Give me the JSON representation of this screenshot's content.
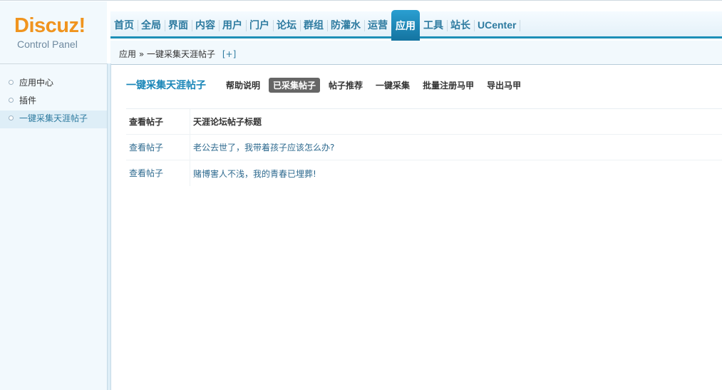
{
  "logo": {
    "word": "Discuz!",
    "sub": "Control Panel"
  },
  "nav": [
    {
      "label": "首页"
    },
    {
      "label": "全局"
    },
    {
      "label": "界面"
    },
    {
      "label": "内容"
    },
    {
      "label": "用户"
    },
    {
      "label": "门户"
    },
    {
      "label": "论坛"
    },
    {
      "label": "群组"
    },
    {
      "label": "防灌水"
    },
    {
      "label": "运营"
    },
    {
      "label": "应用",
      "active": true
    },
    {
      "label": "工具"
    },
    {
      "label": "站长"
    },
    {
      "label": "UCenter"
    }
  ],
  "breadcrumb": {
    "root": "应用",
    "sep": "»",
    "current": "一键采集天涯帖子",
    "plus": "[+]"
  },
  "sidebar": {
    "items": [
      {
        "label": "应用中心"
      },
      {
        "label": "插件"
      },
      {
        "label": "一键采集天涯帖子",
        "active": true
      }
    ]
  },
  "main": {
    "title": "一键采集天涯帖子",
    "tabs": [
      {
        "label": "帮助说明"
      },
      {
        "label": "已采集帖子",
        "active": true
      },
      {
        "label": "帖子推荐"
      },
      {
        "label": "一键采集"
      },
      {
        "label": "批量注册马甲"
      },
      {
        "label": "导出马甲"
      }
    ],
    "table": {
      "headers": [
        "查看帖子",
        "天涯论坛帖子标题"
      ],
      "rows": [
        {
          "action": "查看帖子",
          "title": "老公去世了，我带着孩子应该怎么办?"
        },
        {
          "action": "查看帖子",
          "title": "赌博害人不浅，我的青春已埋葬!"
        }
      ]
    }
  },
  "colors": {
    "accent": "#1d8fb7",
    "logo": "#f0941e",
    "active_tab": "#666666"
  }
}
